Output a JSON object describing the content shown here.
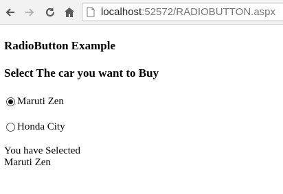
{
  "browser": {
    "url_host": "localhost",
    "url_path": ":52572/RADIOBUTTON.aspx"
  },
  "page": {
    "heading": "RadioButton Example",
    "subheading": "Select The car you want to Buy",
    "options": [
      {
        "label": "Maruti Zen",
        "selected": true
      },
      {
        "label": "Honda City",
        "selected": false
      }
    ],
    "result_label": "You have Selected",
    "result_value": "Maruti Zen"
  }
}
